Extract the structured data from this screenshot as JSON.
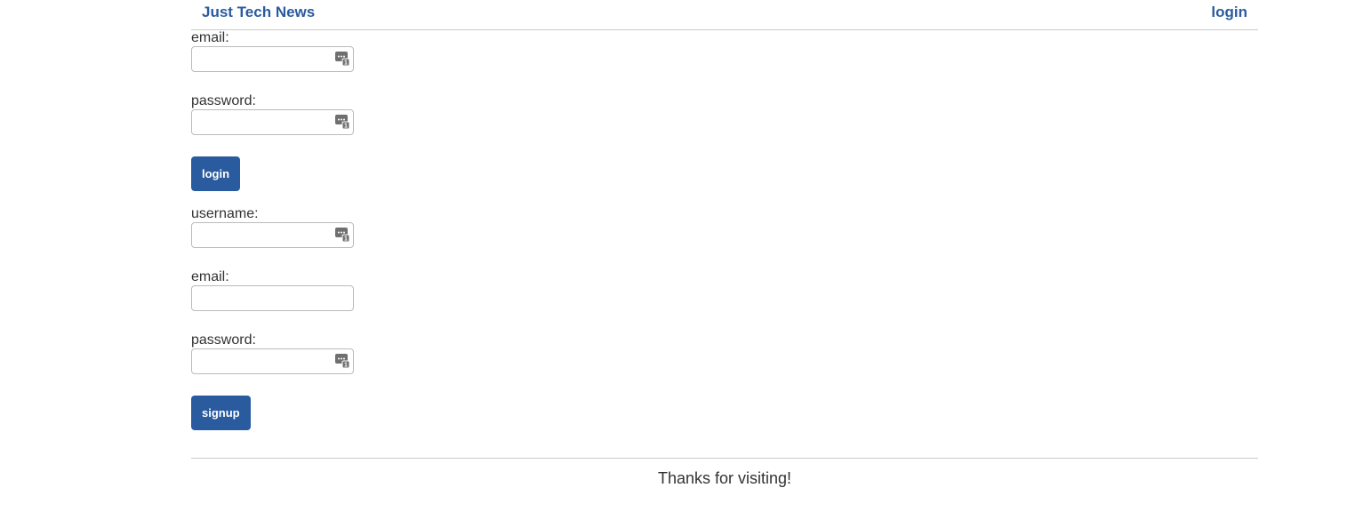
{
  "header": {
    "brand": "Just Tech News",
    "nav_login": "login"
  },
  "login_form": {
    "email_label": "email:",
    "email_value": "",
    "password_label": "password:",
    "password_value": "",
    "submit_label": "login"
  },
  "signup_form": {
    "username_label": "username:",
    "username_value": "",
    "email_label": "email:",
    "email_value": "",
    "password_label": "password:",
    "password_value": "",
    "submit_label": "signup"
  },
  "footer": {
    "text": "Thanks for visiting!"
  },
  "colors": {
    "accent": "#2a5b9f",
    "text": "#333333",
    "divider": "#cccccc"
  },
  "icons": {
    "field_helper": "password-manager-icon"
  }
}
